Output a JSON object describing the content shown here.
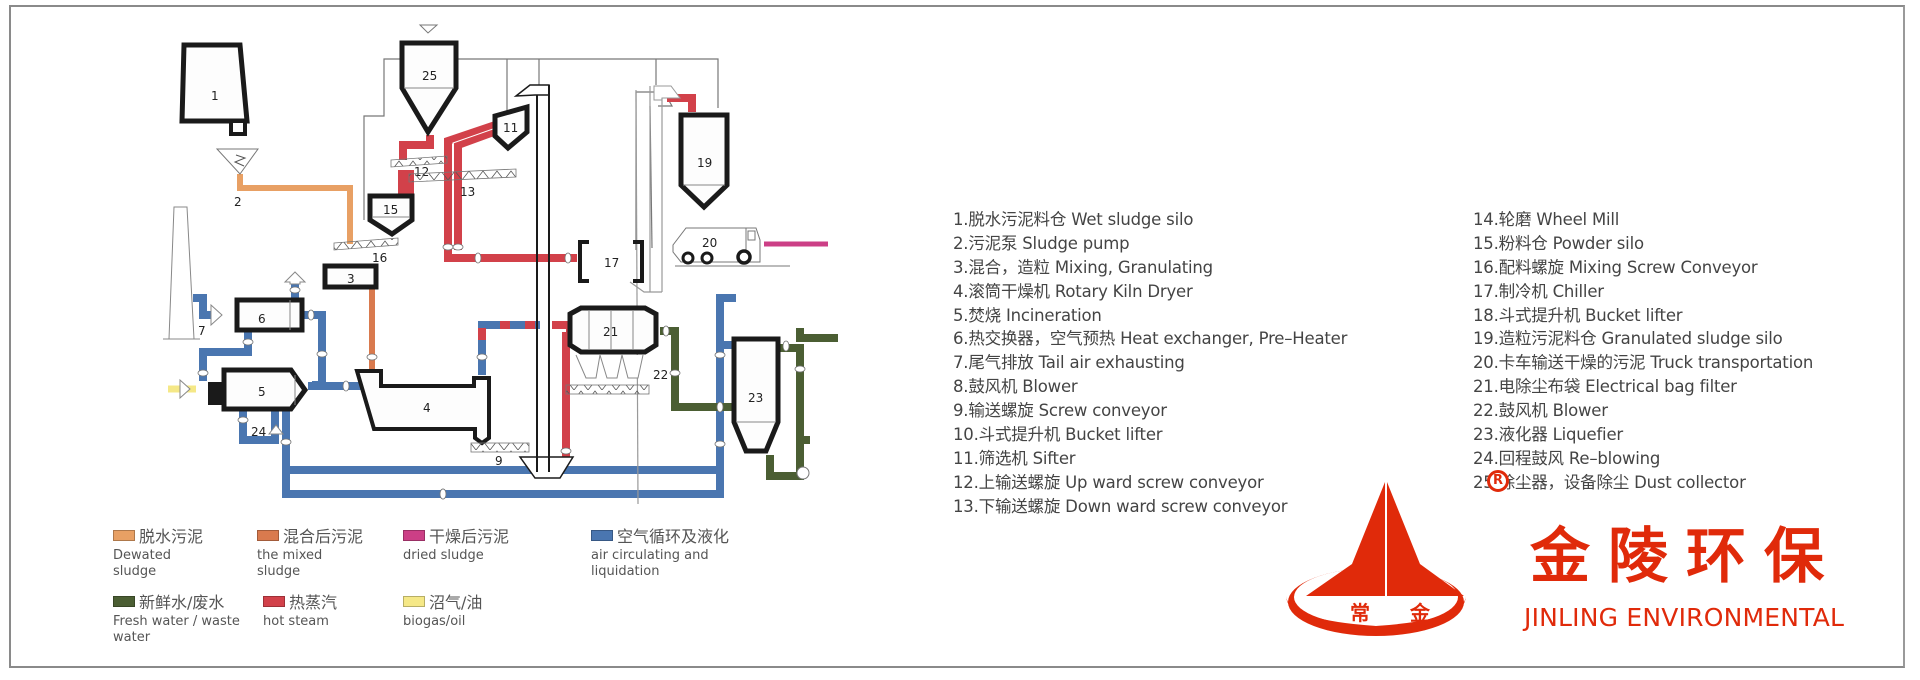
{
  "colors": {
    "dewatered": "#e8a064",
    "mixed": "#d97a4e",
    "dried": "#cc3f86",
    "air": "#4a76b0",
    "water": "#4b5e33",
    "steam": "#d2414a",
    "biogas": "#f5e887",
    "brand": "#e02a0a",
    "outline": "#1a1a1a"
  },
  "diagram": {
    "equipment_labels": {
      "silo1": "1",
      "pump2": "2",
      "mixer3": "3",
      "dryer4": "4",
      "incinerator5": "5",
      "exchanger6": "6",
      "chimney7": "7",
      "conveyor9": "9",
      "sifter11": "11",
      "conveyor12": "12",
      "conveyor13": "13",
      "silo15": "15",
      "conveyor16": "16",
      "chiller17": "17",
      "silo19": "19",
      "truck20": "20",
      "filter21": "21",
      "blower22": "22",
      "liquefier23": "23",
      "reblower24": "24",
      "collector25": "25"
    }
  },
  "equipment_list": {
    "column1": [
      "1.脱水污泥料仓 Wet sludge silo",
      "2.污泥泵 Sludge pump",
      "3.混合，造粒 Mixing, Granulating",
      "4.滚筒干燥机 Rotary Kiln Dryer",
      "5.焚烧 Incineration",
      "6.热交换器，空气预热 Heat exchanger, Pre–Heater",
      "7.尾气排放 Tail air exhausting",
      "8.鼓风机 Blower",
      "9.输送螺旋 Screw conveyor",
      "10.斗式提升机 Bucket lifter",
      "11.筛选机 Sifter",
      "12.上输送螺旋 Up ward screw conveyor",
      "13.下输送螺旋 Down ward screw conveyor"
    ],
    "column2": [
      "14.轮磨 Wheel Mill",
      "15.粉料仓 Powder silo",
      "16.配料螺旋 Mixing Screw Conveyor",
      "17.制冷机 Chiller",
      "18.斗式提升机 Bucket lifter",
      "19.造粒污泥料仓 Granulated sludge silo",
      "20.卡车输送干燥的污泥 Truck transportation",
      "21.电除尘布袋 Electrical bag filter",
      "22.鼓风机 Blower",
      "23.液化器 Liquefier",
      "24.回程鼓风 Re–blowing",
      "25.除尘器，设备除尘 Dust collector"
    ]
  },
  "legend": [
    {
      "zh": "脱水污泥",
      "en": "Dewated sludge",
      "color": "#e8a064"
    },
    {
      "zh": "混合后污泥",
      "en": "the mixed sludge",
      "color": "#d97a4e"
    },
    {
      "zh": "干燥后污泥",
      "en": "dried sludge",
      "color": "#cc3f86"
    },
    {
      "zh": "空气循环及液化",
      "en": "air circulating and liquidation",
      "color": "#4a76b0"
    },
    {
      "zh": "新鲜水/废水",
      "en": "Fresh water / waste water",
      "color": "#4b5e33"
    },
    {
      "zh": "热蒸汽",
      "en": "hot steam",
      "color": "#d2414a"
    },
    {
      "zh": "沼气/油",
      "en": "biogas/oil",
      "color": "#f5e887"
    }
  ],
  "brand": {
    "name_zh": "金陵环保",
    "name_en": "JINLING ENVIRONMENTAL",
    "emblem_left": "常",
    "emblem_right": "金",
    "registered_mark": "R"
  }
}
